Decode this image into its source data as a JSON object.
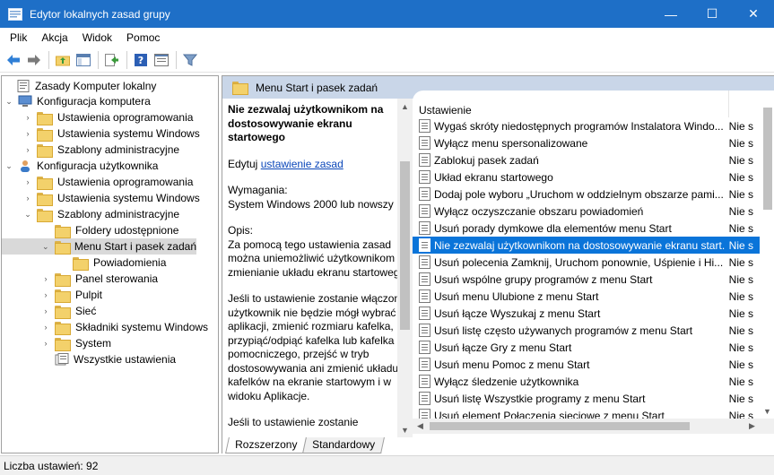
{
  "window": {
    "title": "Edytor lokalnych zasad grupy",
    "minimize": "—",
    "maximize": "☐",
    "close": "✕"
  },
  "menu": [
    "Plik",
    "Akcja",
    "Widok",
    "Pomoc"
  ],
  "tree": [
    {
      "label": "Zasady Komputer lokalny",
      "icon": "policy-icon",
      "expander": ""
    },
    {
      "label": "Konfiguracja komputera",
      "icon": "computer-icon",
      "expander": "⌄"
    },
    {
      "label": "Ustawienia oprogramowania",
      "icon": "folder-icon",
      "expander": "›"
    },
    {
      "label": "Ustawienia systemu Windows",
      "icon": "folder-icon",
      "expander": "›"
    },
    {
      "label": "Szablony administracyjne",
      "icon": "folder-icon",
      "expander": "›"
    },
    {
      "label": "Konfiguracja użytkownika",
      "icon": "user-icon",
      "expander": "⌄"
    },
    {
      "label": "Ustawienia oprogramowania",
      "icon": "folder-icon",
      "expander": "›"
    },
    {
      "label": "Ustawienia systemu Windows",
      "icon": "folder-icon",
      "expander": "›"
    },
    {
      "label": "Szablony administracyjne",
      "icon": "folder-icon",
      "expander": "⌄"
    },
    {
      "label": "Foldery udostępnione",
      "icon": "folder-icon",
      "expander": ""
    },
    {
      "label": "Menu Start i pasek zadań",
      "icon": "folder-open-icon",
      "expander": "⌄",
      "selected": true
    },
    {
      "label": "Powiadomienia",
      "icon": "folder-icon",
      "expander": ""
    },
    {
      "label": "Panel sterowania",
      "icon": "folder-icon",
      "expander": "›"
    },
    {
      "label": "Pulpit",
      "icon": "folder-icon",
      "expander": "›"
    },
    {
      "label": "Sieć",
      "icon": "folder-icon",
      "expander": "›"
    },
    {
      "label": "Składniki systemu Windows",
      "icon": "folder-icon",
      "expander": "›"
    },
    {
      "label": "System",
      "icon": "folder-icon",
      "expander": "›"
    },
    {
      "label": "Wszystkie ustawienia",
      "icon": "settings-list-icon",
      "expander": ""
    }
  ],
  "panel": {
    "header": "Menu Start i pasek zadań"
  },
  "description": {
    "title": "Nie zezwalaj użytkownikom na dostosowywanie ekranu startowego",
    "edit_prefix": "Edytuj ",
    "edit_link": "ustawienie zasad ",
    "requirements_label": "Wymagania:",
    "requirements_value": "System Windows 2000 lub nowszy",
    "opis_label": "Opis:",
    "opis_text": "Za pomocą tego ustawienia zasad można uniemożliwić użytkownikom zmienianie układu ekranu startowego.",
    "para2": "Jeśli to ustawienie zostanie włączone, użytkownik nie będzie mógł wybrać aplikacji, zmienić rozmiaru kafelka, przypiąć/odpiąć kafelka lub kafelka pomocniczego, przejść w tryb dostosowywania ani zmienić układu kafelków na ekranie startowym i w widoku Aplikacje.",
    "para3": "Jeśli to ustawienie zostanie"
  },
  "list": {
    "col_setting": "Ustawienie",
    "col_state": "",
    "rows": [
      {
        "name": "Wygaś skróty niedostępnych programów Instalatora Windo...",
        "state": "Nie s"
      },
      {
        "name": "Wyłącz menu spersonalizowane",
        "state": "Nie s"
      },
      {
        "name": "Zablokuj pasek zadań",
        "state": "Nie s"
      },
      {
        "name": "Układ ekranu startowego",
        "state": "Nie s"
      },
      {
        "name": "Dodaj pole wyboru „Uruchom w oddzielnym obszarze pami...",
        "state": "Nie s"
      },
      {
        "name": "Wyłącz oczyszczanie obszaru powiadomień",
        "state": "Nie s"
      },
      {
        "name": "Usuń porady dymkowe dla elementów menu Start",
        "state": "Nie s"
      },
      {
        "name": "Nie zezwalaj użytkownikom na dostosowywanie ekranu start...",
        "state": "Nie s",
        "selected": true
      },
      {
        "name": "Usuń polecenia Zamknij, Uruchom ponownie, Uśpienie i Hi...",
        "state": "Nie s"
      },
      {
        "name": "Usuń wspólne grupy programów z menu Start",
        "state": "Nie s"
      },
      {
        "name": "Usuń menu Ulubione z menu Start",
        "state": "Nie s"
      },
      {
        "name": "Usuń łącze Wyszukaj z menu Start",
        "state": "Nie s"
      },
      {
        "name": "Usuń listę często używanych programów z menu Start",
        "state": "Nie s"
      },
      {
        "name": "Usuń łącze Gry z menu Start",
        "state": "Nie s"
      },
      {
        "name": "Usuń menu Pomoc z menu Start",
        "state": "Nie s"
      },
      {
        "name": "Wyłącz śledzenie użytkownika",
        "state": "Nie s"
      },
      {
        "name": "Usuń listę Wszystkie programy z menu Start",
        "state": "Nie s"
      },
      {
        "name": "Usuń element Połączenia sieciowe z menu Start",
        "state": "Nie s"
      }
    ]
  },
  "tabs": [
    "Rozszerzony",
    "Standardowy"
  ],
  "status": {
    "text": "Liczba ustawień: 92"
  },
  "colors": {
    "titlebar": "#1e6fc7",
    "header": "#c9d6e8",
    "selection": "#0a74d9"
  }
}
